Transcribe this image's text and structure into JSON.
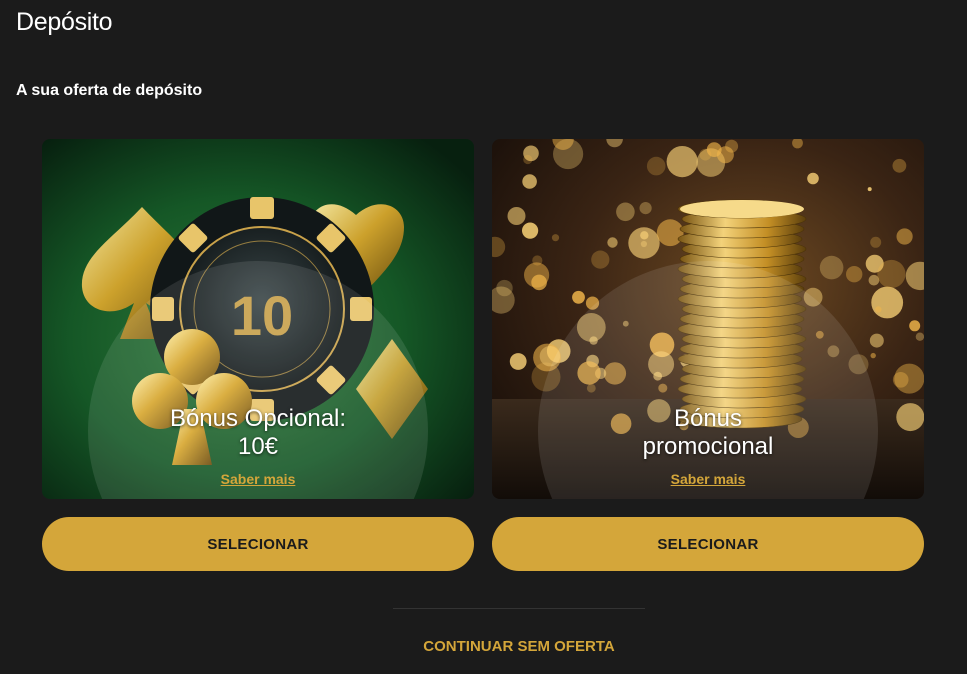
{
  "page": {
    "title": "Depósito",
    "section_title": "A sua oferta de depósito"
  },
  "offers": [
    {
      "title_line1": "Bónus Opcional:",
      "title_line2": "10€",
      "link_label": "Saber mais",
      "button_label": "SELECIONAR",
      "chip_value": "10"
    },
    {
      "title_line1": "Bónus",
      "title_line2": "promocional",
      "link_label": "Saber mais",
      "button_label": "SELECIONAR"
    }
  ],
  "footer": {
    "continue_label": "CONTINUAR SEM OFERTA"
  },
  "colors": {
    "background": "#1b1b1b",
    "accent_gold": "#d4a63a",
    "text": "#ffffff"
  }
}
